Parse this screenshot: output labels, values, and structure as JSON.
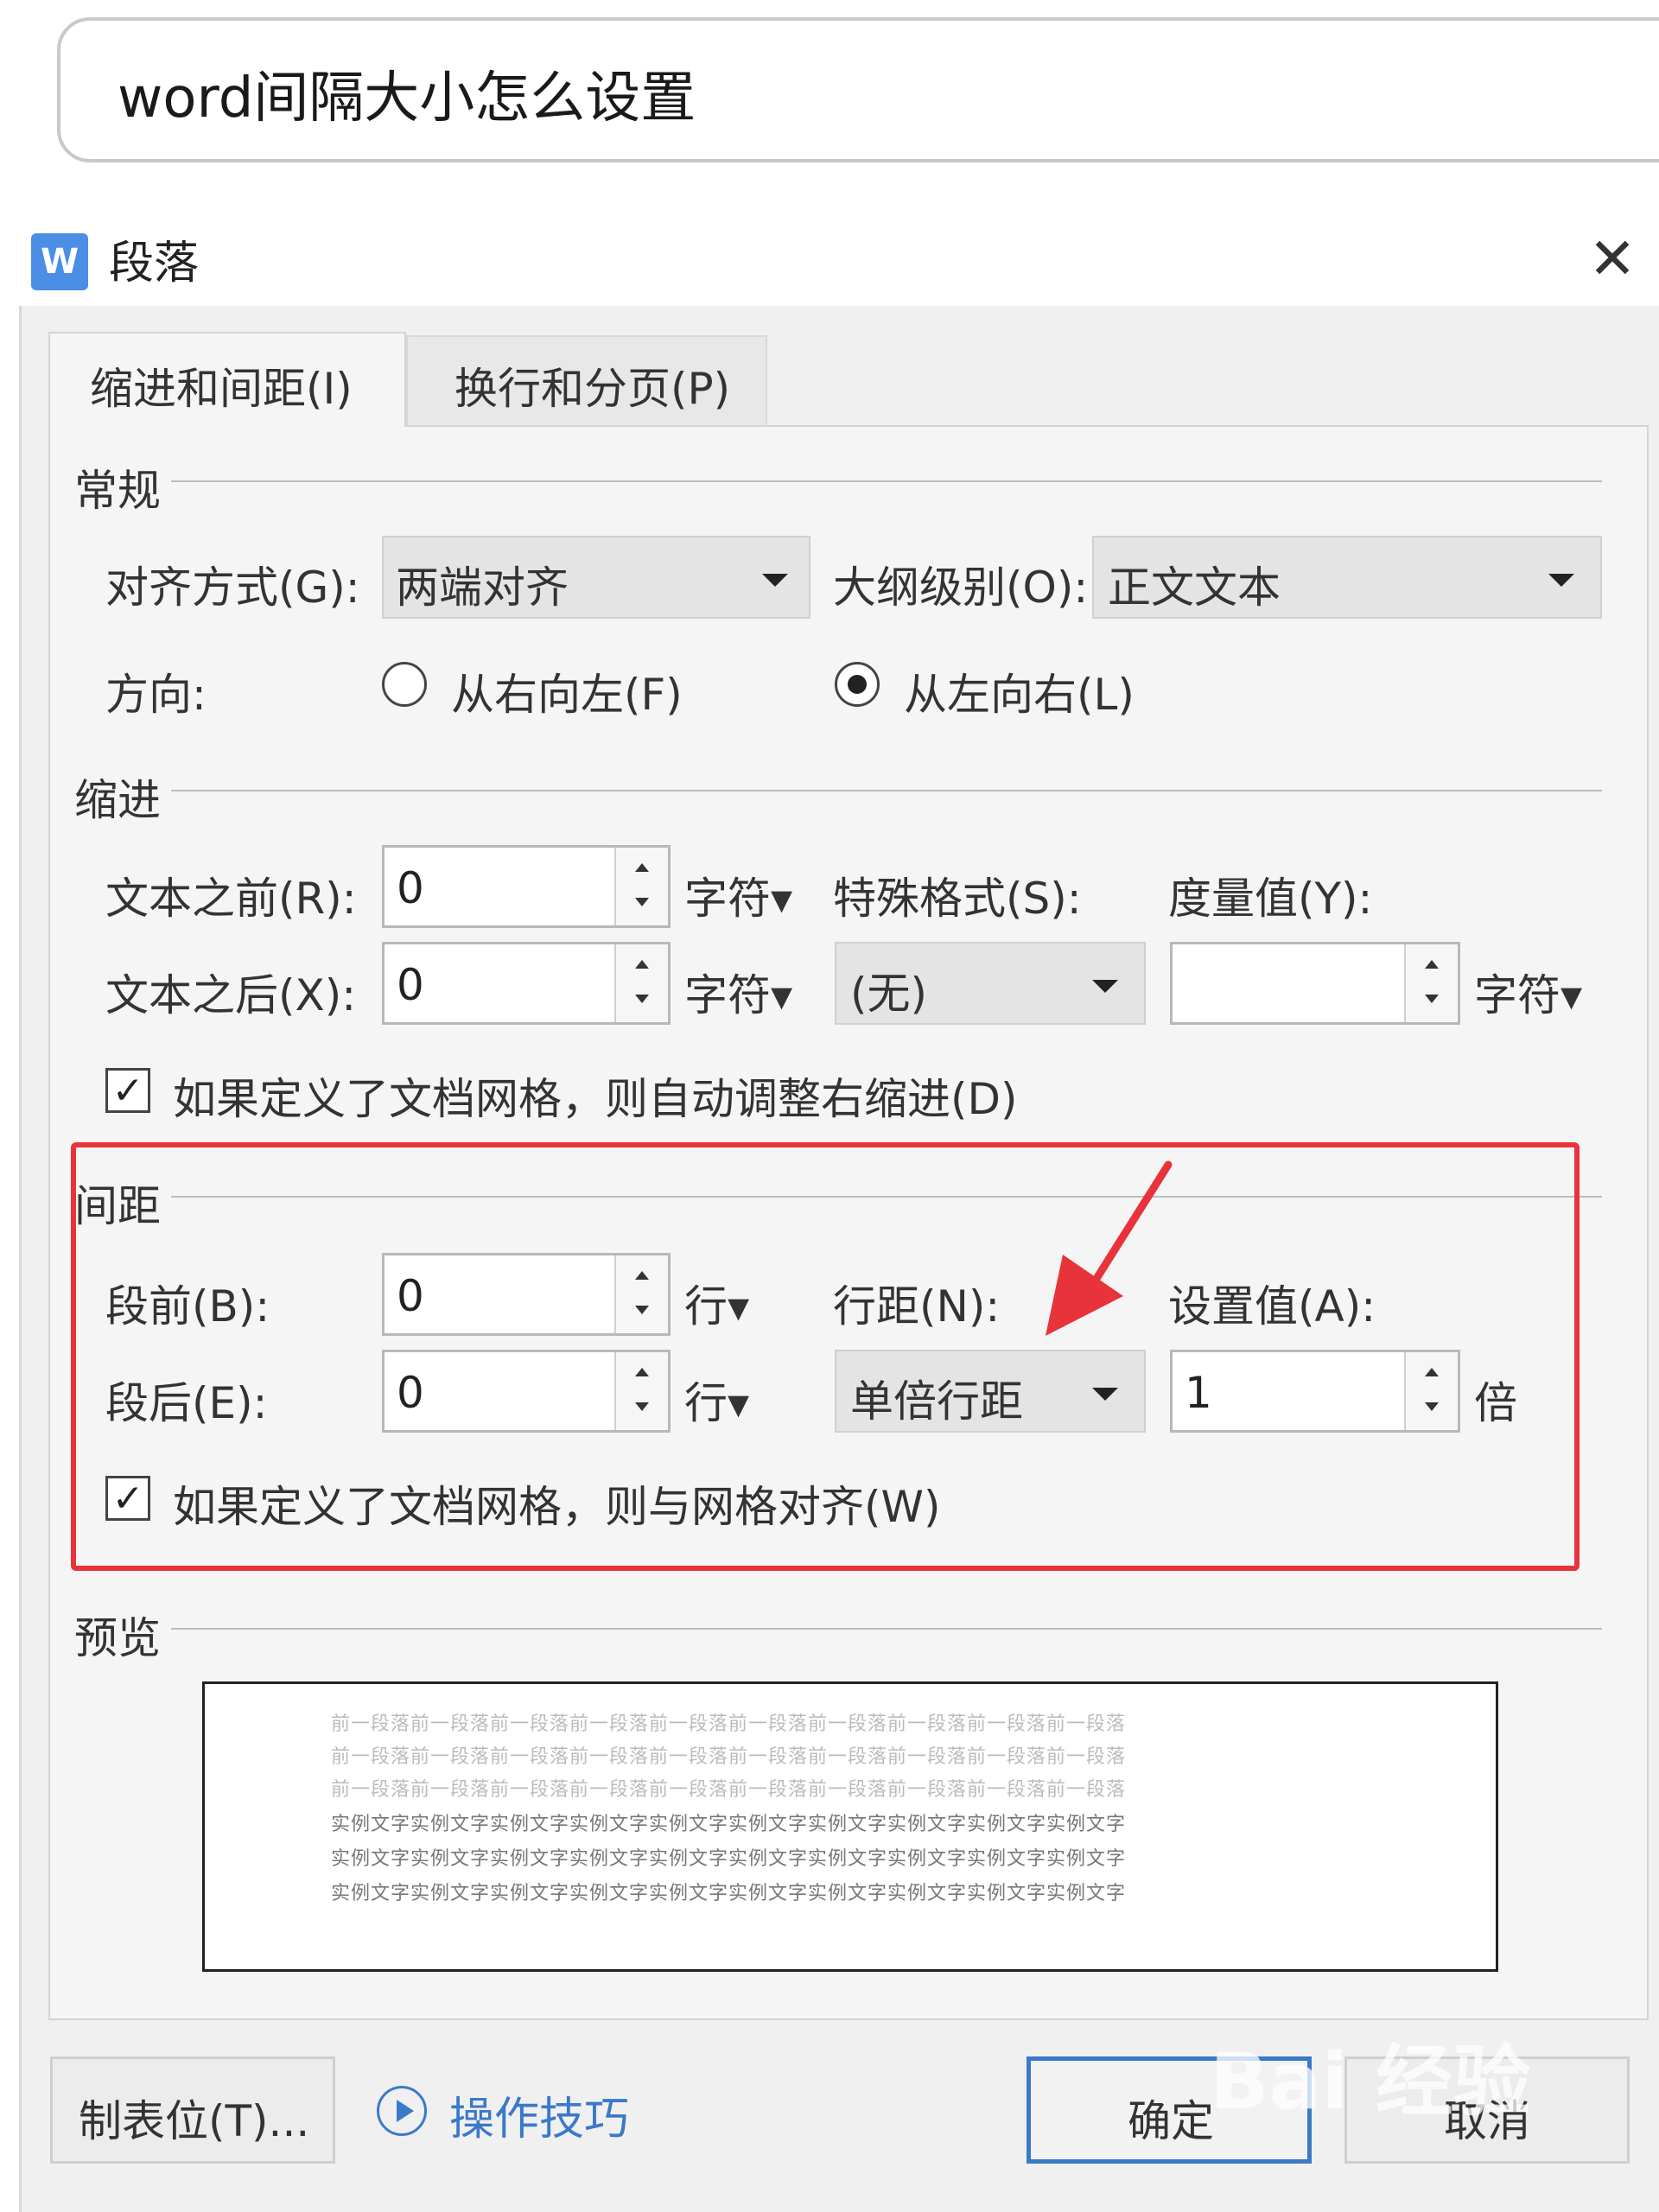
{
  "search": {
    "query": "word间隔大小怎么设置"
  },
  "dialog": {
    "app_icon": "W",
    "title": "段落",
    "close_icon": "close-icon",
    "tabs": [
      {
        "label": "缩进和间距(I)",
        "active": true
      },
      {
        "label": "换行和分页(P)",
        "active": false
      }
    ],
    "general": {
      "section_label": "常规",
      "alignment_label": "对齐方式(G):",
      "alignment_value": "两端对齐",
      "outline_label": "大纲级别(O):",
      "outline_value": "正文文本",
      "direction_label": "方向:",
      "rtl_label": "从右向左(F)",
      "ltr_label": "从左向右(L)",
      "direction_selected": "从左向右(L)"
    },
    "indent": {
      "section_label": "缩进",
      "before_label": "文本之前(R):",
      "before_value": "0",
      "before_unit": "字符▾",
      "after_label": "文本之后(X):",
      "after_value": "0",
      "after_unit": "字符▾",
      "special_label": "特殊格式(S):",
      "special_value": "(无)",
      "measure_label": "度量值(Y):",
      "measure_value": "",
      "measure_unit": "字符▾",
      "auto_adjust_label": "如果定义了文档网格，则自动调整右缩进(D)",
      "auto_adjust_checked": true
    },
    "spacing": {
      "section_label": "间距",
      "before_label": "段前(B):",
      "before_value": "0",
      "before_unit": "行▾",
      "after_label": "段后(E):",
      "after_value": "0",
      "after_unit": "行▾",
      "line_spacing_label": "行距(N):",
      "line_spacing_value": "单倍行距",
      "setting_label": "设置值(A):",
      "setting_value": "1",
      "setting_unit": "倍",
      "snap_grid_label": "如果定义了文档网格，则与网格对齐(W)",
      "snap_grid_checked": true
    },
    "preview": {
      "section_label": "预览",
      "lines": [
        "前一段落前一段落前一段落前一段落前一段落前一段落前一段落前一段落前一段落前一段落",
        "前一段落前一段落前一段落前一段落前一段落前一段落前一段落前一段落前一段落前一段落",
        "前一段落前一段落前一段落前一段落前一段落前一段落前一段落前一段落前一段落前一段落",
        "实例文字实例文字实例文字实例文字实例文字实例文字实例文字实例文字实例文字实例文字",
        "实例文字实例文字实例文字实例文字实例文字实例文字实例文字实例文字实例文字实例文字",
        "实例文字实例文字实例文字实例文字实例文字实例文字实例文字实例文字实例文字实例文字"
      ]
    },
    "footer": {
      "tabs_button": "制表位(T)...",
      "tips_label": "操作技巧",
      "ok_button": "确定",
      "cancel_button": "取消"
    }
  },
  "watermark": {
    "text": "Bai 经验"
  },
  "colors": {
    "highlight": "#e8333b",
    "accent": "#3b79c9",
    "app_icon": "#4a8ee6"
  }
}
